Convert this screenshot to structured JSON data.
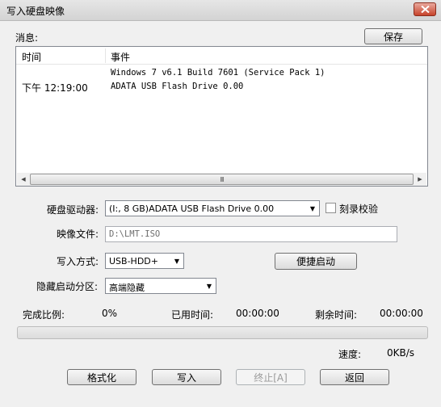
{
  "window": {
    "title": "写入硬盘映像"
  },
  "messages": {
    "label": "消息:",
    "save_label": "保存",
    "columns": [
      "时间",
      "事件"
    ],
    "rows": [
      {
        "time": "",
        "event": "Windows 7 v6.1 Build 7601 (Service Pack 1)"
      },
      {
        "time": "下午 12:19:00",
        "event": "ADATA   USB Flash Drive 0.00"
      }
    ],
    "scroll_grip": "III"
  },
  "form": {
    "drive_label": "硬盘驱动器:",
    "drive_value": "(I:, 8 GB)ADATA   USB Flash Drive 0.00",
    "verify_label": "刻录校验",
    "verify_checked": false,
    "image_label": "映像文件:",
    "image_value": "D:\\LMT.ISO",
    "method_label": "写入方式:",
    "method_value": "USB-HDD+",
    "quick_boot_label": "便捷启动",
    "hidden_label": "隐藏启动分区:",
    "hidden_value": "高端隐藏"
  },
  "progress": {
    "ratio_label": "完成比例:",
    "ratio_value": "0%",
    "fraction": 0,
    "elapsed_label": "已用时间:",
    "elapsed_value": "00:00:00",
    "remaining_label": "剩余时间:",
    "remaining_value": "00:00:00",
    "speed_label": "速度:",
    "speed_value": "0KB/s"
  },
  "buttons": {
    "format": "格式化",
    "write": "写入",
    "stop": "终止[A]",
    "back": "返回"
  }
}
